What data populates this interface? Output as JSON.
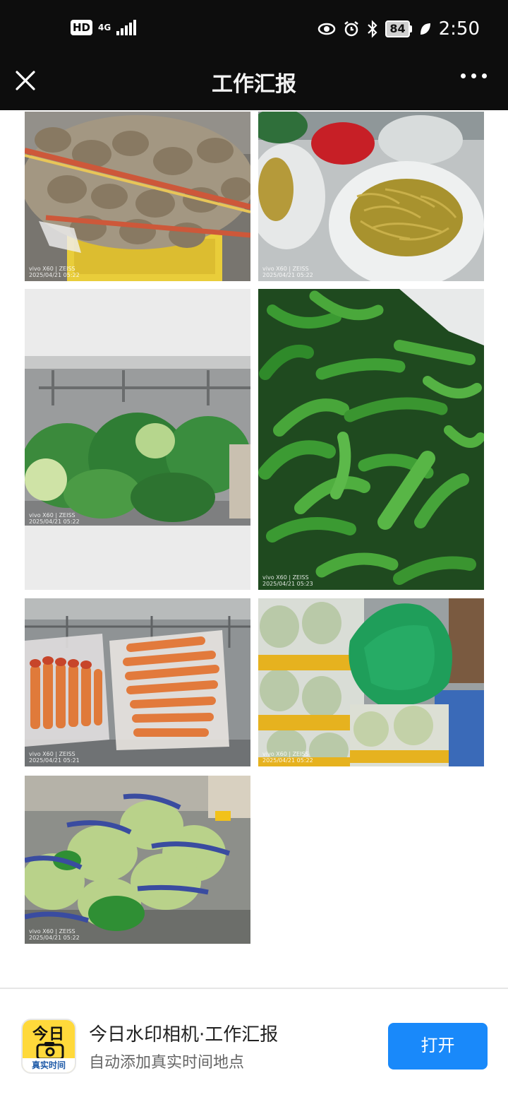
{
  "status_bar": {
    "hd_label": "HD",
    "network": "4G",
    "battery": "84",
    "time": "2:50",
    "icons": [
      "eye-icon",
      "alarm-icon",
      "bluetooth-icon",
      "leaf-icon"
    ]
  },
  "nav": {
    "title": "工作汇报",
    "close_icon": "close-icon",
    "more_icon": "more-icon"
  },
  "photos": [
    {
      "subject": "potatoes",
      "watermark_model": "vivo X60 | ZEISS",
      "watermark_date": "2025/04/21 05:22"
    },
    {
      "subject": "pickled-peppers",
      "watermark_model": "vivo X60 | ZEISS",
      "watermark_date": "2025/04/21 05:22"
    },
    {
      "subject": "cabbage",
      "watermark_model": "vivo X60 | ZEISS",
      "watermark_date": "2025/04/21 05:22"
    },
    {
      "subject": "green-peppers",
      "watermark_model": "vivo X60 | ZEISS",
      "watermark_date": "2025/04/21 05:23"
    },
    {
      "subject": "carrots",
      "watermark_model": "vivo X60 | ZEISS",
      "watermark_date": "2025/04/21 05:21"
    },
    {
      "subject": "napa-cabbage",
      "watermark_model": "vivo X60 | ZEISS",
      "watermark_date": "2025/04/21 05:22"
    },
    {
      "subject": "bok-choy",
      "watermark_model": "vivo X60 | ZEISS",
      "watermark_date": "2025/04/21 05:22"
    }
  ],
  "banner": {
    "icon_top": "今日",
    "icon_bottom": "真实时间",
    "title": "今日水印相机·工作汇报",
    "subtitle": "自动添加真实时间地点",
    "open_label": "打开"
  },
  "colors": {
    "status_bg": "#0d0d0d",
    "accent": "#1989fa",
    "app_icon": "#ffd93b"
  }
}
